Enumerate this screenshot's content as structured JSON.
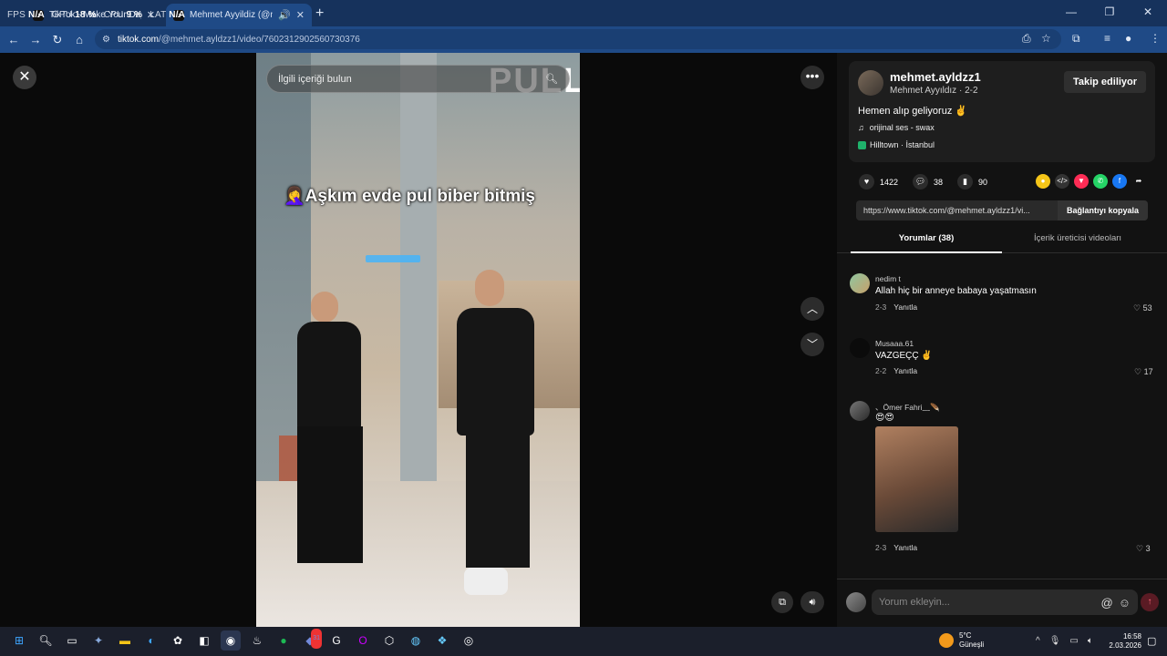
{
  "overlay": {
    "fps_label": "FPS",
    "fps_value": "N/A",
    "gpu_label": "GPU",
    "gpu_value": "18 %",
    "cpu_label": "CPU",
    "cpu_value": "9 %",
    "lat_label": "LAT",
    "lat_value": "N/A"
  },
  "tabs": [
    {
      "title": "TikTok - Make Your Day",
      "favicon": "tiktok-icon"
    },
    {
      "title": "Mehmet Ayyildiz (@mehm",
      "favicon": "tiktok-icon"
    }
  ],
  "address": {
    "host": "tiktok.com",
    "path": "/@mehmet.ayldzz1/video/7602312902560730376"
  },
  "video": {
    "search_placeholder": "İlgili içeriği bulun",
    "caption": "🤦‍♀️Aşkım evde pul biber bitmiş",
    "store_sign": "PULL"
  },
  "author": {
    "username": "mehmet.ayldzz1",
    "display_name": "Mehmet Ayyıldız",
    "date": "2-2",
    "follow_label": "Takip ediliyor",
    "description": "Hemen alıp geliyoruz ✌️",
    "music": "orijinal ses - swax",
    "location": "Hilltown · İstanbul"
  },
  "stats": {
    "likes": "1422",
    "comments": "38",
    "saves": "90"
  },
  "share_icons": [
    "coin-icon",
    "embed-icon",
    "send-icon",
    "whatsapp-icon",
    "facebook-icon",
    "share-arrow-icon"
  ],
  "link": {
    "url": "https://www.tiktok.com/@mehmet.ayldzz1/vi...",
    "copy_label": "Bağlantıyı kopyala"
  },
  "panel_tabs": {
    "comments": "Yorumlar (38)",
    "creator_videos": "İçerik üreticisi videoları"
  },
  "comments": [
    {
      "name": "nedim t",
      "text": "Allah hiç bir anneye babaya yaşatmasın",
      "date": "2-3",
      "reply": "Yanıtla",
      "likes": "53"
    },
    {
      "name": "Musaaa.61",
      "text": "VAZGEÇÇ ✌️",
      "date": "2-2",
      "reply": "Yanıtla",
      "likes": "17"
    },
    {
      "name": "、Ömer Fahri﹏🪶",
      "text": "😍😍",
      "date": "2-3",
      "reply": "Yanıtla",
      "likes": "3"
    }
  ],
  "comment_input": {
    "placeholder": "Yorum ekleyin..."
  },
  "taskbar": {
    "weather_temp": "5°C",
    "weather_desc": "Güneşli",
    "time": "16:58",
    "date": "2.03.2026",
    "discord_badge": "31"
  },
  "colors": {
    "tab_bar": "#16325c",
    "address_bar": "#1f4a86",
    "panel_bg": "#121212",
    "accent_red": "#fe2c55"
  }
}
